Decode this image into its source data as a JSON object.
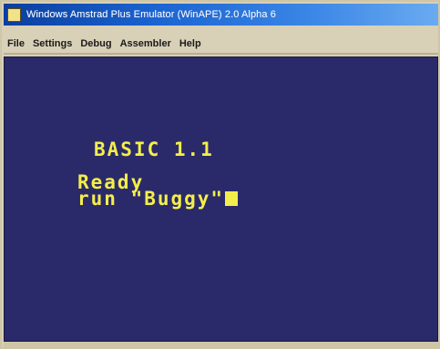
{
  "window": {
    "title": "Windows Amstrad Plus Emulator (WinAPE) 2.0 Alpha 6"
  },
  "menu": {
    "items": [
      "File",
      "Settings",
      "Debug",
      "Assembler",
      "Help"
    ]
  },
  "screen": {
    "background": "#2a2a6a",
    "text_color": "#f4ee4a",
    "lines": {
      "basic": "BASIC 1.1",
      "ready": "Ready",
      "run": "run \"Buggy\""
    }
  }
}
